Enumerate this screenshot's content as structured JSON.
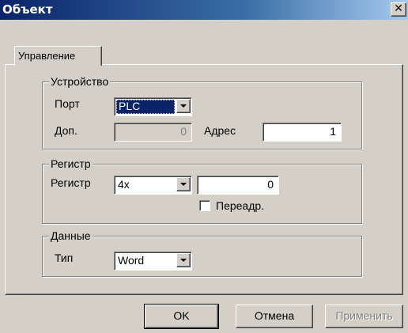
{
  "window": {
    "title": "Объект",
    "close_glyph": "✕"
  },
  "tabs": [
    {
      "label": "Управление"
    }
  ],
  "device_group": {
    "legend": "Устройство",
    "port_label": "Порт",
    "port_value": "PLC",
    "extra_label": "Доп.",
    "extra_value": "0",
    "address_label": "Адрес",
    "address_value": "1"
  },
  "register_group": {
    "legend": "Регистр",
    "register_label": "Регистр",
    "register_type": "4x",
    "register_value": "0",
    "redirect_label": "Переадр.",
    "redirect_checked": false
  },
  "data_group": {
    "legend": "Данные",
    "type_label": "Тип",
    "type_value": "Word"
  },
  "buttons": {
    "ok": "OK",
    "cancel": "Отмена",
    "apply": "Применить"
  },
  "colors": {
    "titlebar_start": "#0a246a",
    "face": "#d4d0c8",
    "selection": "#0a246a"
  }
}
